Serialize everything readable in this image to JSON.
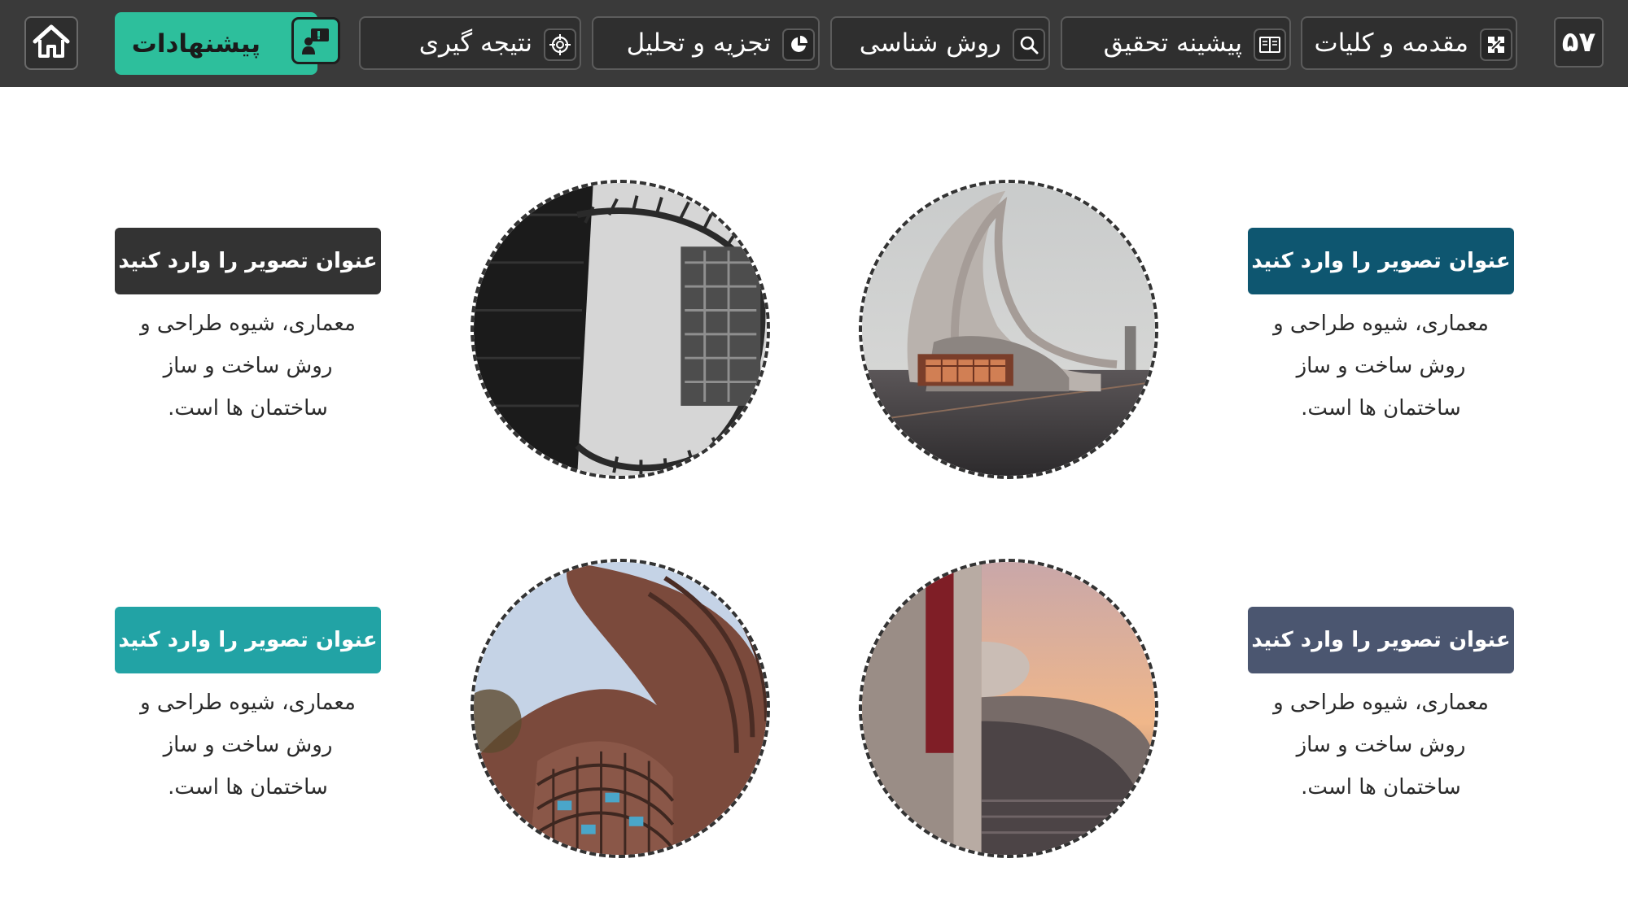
{
  "topbar": {
    "page_number": "۵۷",
    "nav": [
      {
        "id": "intro",
        "label": "مقدمه و کلیات",
        "icon": "puzzle-icon"
      },
      {
        "id": "background",
        "label": "پیشینه تحقیق",
        "icon": "book-icon"
      },
      {
        "id": "method",
        "label": "روش شناسی",
        "icon": "search-icon"
      },
      {
        "id": "analysis",
        "label": "تجزیه و تحلیل",
        "icon": "pie-chart-icon"
      },
      {
        "id": "conclusion",
        "label": "نتیجه گیری",
        "icon": "target-icon"
      },
      {
        "id": "suggestions",
        "label": "پیشنهادات",
        "icon": "presenter-icon",
        "active": true
      }
    ],
    "home_icon": "home-icon"
  },
  "cards": [
    {
      "title": "عنوان تصویر را وارد کنید",
      "title_color": "#0e5670",
      "description": [
        "معماری، شیوه طراحی و",
        "روش ساخت و ساز",
        "ساختمان ها است."
      ],
      "image": "futuristic-curved-building-photo"
    },
    {
      "title": "عنوان تصویر را وارد کنید",
      "title_color": "#333333",
      "description": [
        "معماری، شیوه طراحی و",
        "روش ساخت و ساز",
        "ساختمان ها است."
      ],
      "image": "black-and-white-courtyard-photo"
    },
    {
      "title": "عنوان تصویر را وارد کنید",
      "title_color": "#4b5670",
      "description": [
        "معماری، شیوه طراحی و",
        "روش ساخت و ساز",
        "ساختمان ها است."
      ],
      "image": "sunset-concrete-building-photo"
    },
    {
      "title": "عنوان تصویر را وارد کنید",
      "title_color": "#22a3a5",
      "description": [
        "معماری، شیوه طراحی و",
        "روش ساخت و ساز",
        "ساختمان ها است."
      ],
      "image": "curved-facade-tower-photo"
    }
  ],
  "colors": {
    "topbar_bg": "#3a3a3a",
    "active_accent": "#2dbf9c"
  }
}
